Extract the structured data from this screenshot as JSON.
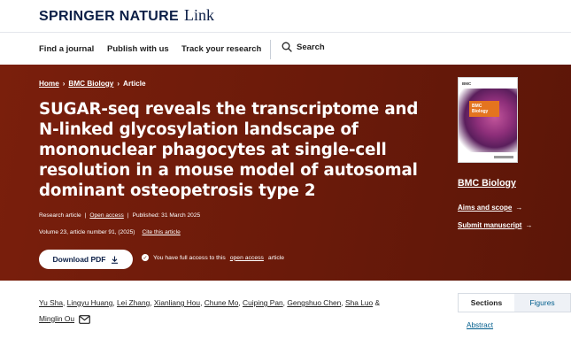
{
  "brand": {
    "name": "SPRINGER NATURE",
    "suffix": "Link"
  },
  "nav": {
    "items": [
      "Find a journal",
      "Publish with us",
      "Track your research"
    ],
    "search_label": "Search"
  },
  "breadcrumb": [
    "Home",
    "BMC Biology",
    "Article"
  ],
  "article": {
    "title": "SUGAR-seq reveals the transcriptome and N-linked glycosylation landscape of mononuclear phagocytes at single-cell resolution in a mouse model of autosomal dominant osteopetrosis type 2",
    "type": "Research article",
    "access": "Open access",
    "published": "Published: 31 March 2025",
    "volume": "Volume 23, article number 91, (2025)",
    "cite": "Cite this article"
  },
  "actions": {
    "pdf_label": "Download PDF",
    "access_prefix": "You have full access to this",
    "access_link": "open access",
    "access_suffix": "article"
  },
  "journal": {
    "cover_logo": "BMC",
    "cover_label": "BMC Biology",
    "name": "BMC Biology",
    "aims": "Aims and scope",
    "submit": "Submit manuscript"
  },
  "authors": [
    "Yu Sha",
    "Lingyu Huang",
    "Lei Zhang",
    "Xianliang Hou",
    "Chune Mo",
    "Cuiping Pan",
    "Gengshuo Chen",
    "Sha Luo",
    "Minglin Ou"
  ],
  "sections": {
    "tab_sections": "Sections",
    "tab_figures": "Figures",
    "first_link": "Abstract"
  },
  "colors": {
    "hero": "#6a1a0a",
    "brand": "#0c1f47",
    "link": "#025e8d"
  }
}
